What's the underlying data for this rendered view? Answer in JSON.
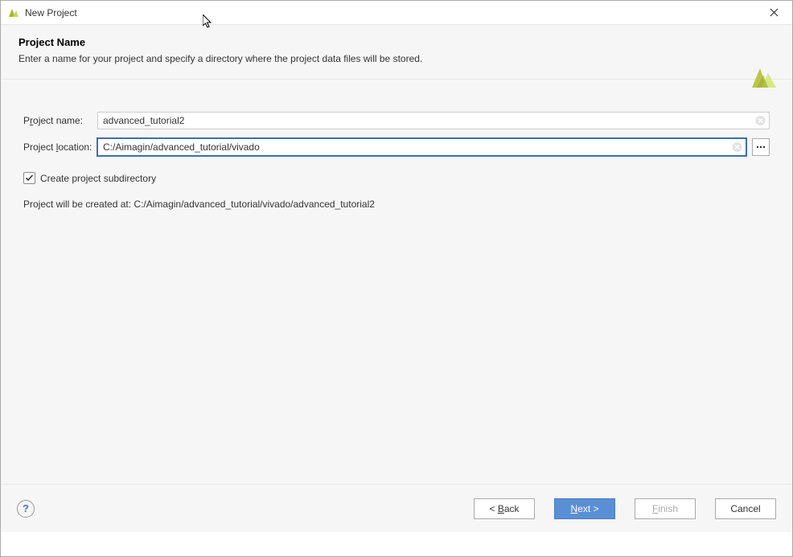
{
  "titlebar": {
    "title": "New Project"
  },
  "header": {
    "title": "Project Name",
    "description": "Enter a name for your project and specify a directory where the project data files will be stored."
  },
  "form": {
    "project_name": {
      "label_pre": "P",
      "label_u": "r",
      "label_post": "oject name:",
      "value": "advanced_tutorial2"
    },
    "project_location": {
      "label_pre": "Project ",
      "label_u": "l",
      "label_post": "ocation:",
      "value": "C:/Aimagin/advanced_tutorial/vivado"
    },
    "create_subdir": {
      "label": "Create project subdirectory",
      "checked": true
    },
    "creation_path": "Project will be created at: C:/Aimagin/advanced_tutorial/vivado/advanced_tutorial2"
  },
  "footer": {
    "help": "?",
    "back_pre": "< ",
    "back_u": "B",
    "back_post": "ack",
    "next_u": "N",
    "next_post": "ext >",
    "finish_u": "F",
    "finish_post": "inish",
    "cancel": "Cancel"
  }
}
